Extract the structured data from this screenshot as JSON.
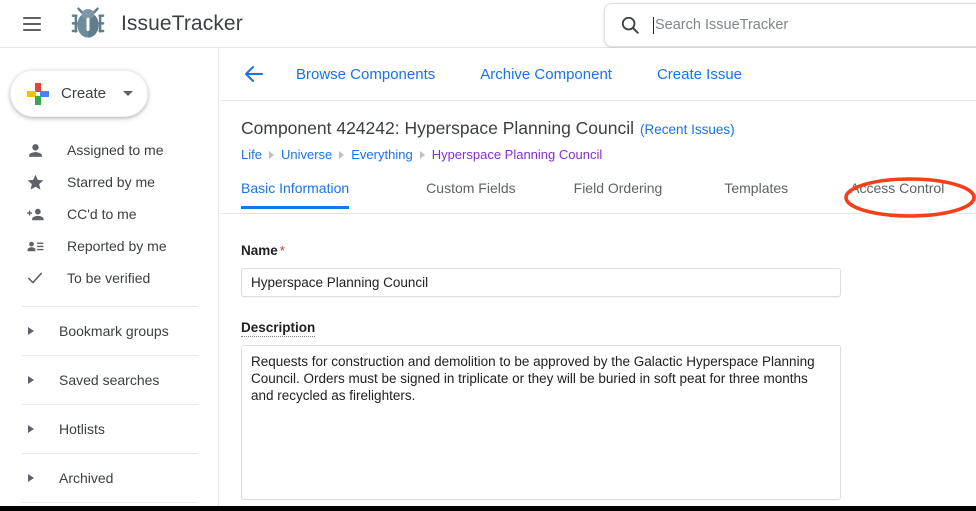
{
  "header": {
    "menu_icon": "hamburger-menu-icon",
    "logo_icon": "bug-logo-icon",
    "brand": "IssueTracker",
    "search": {
      "icon": "search-icon",
      "placeholder": "Search IssueTracker",
      "value": ""
    }
  },
  "sidebar": {
    "create": {
      "label": "Create",
      "plus_icon": "google-plus-icon",
      "caret_icon": "chevron-down-icon"
    },
    "nav_items": [
      {
        "label": "Assigned to me",
        "icon": "person-icon"
      },
      {
        "label": "Starred by me",
        "icon": "star-icon"
      },
      {
        "label": "CC'd to me",
        "icon": "person-add-icon"
      },
      {
        "label": "Reported by me",
        "icon": "person-list-icon"
      },
      {
        "label": "To be verified",
        "icon": "check-icon"
      }
    ],
    "groups": [
      {
        "label": "Bookmark groups",
        "icon": "triangle-right-icon"
      },
      {
        "label": "Saved searches",
        "icon": "triangle-right-icon"
      },
      {
        "label": "Hotlists",
        "icon": "triangle-right-icon"
      },
      {
        "label": "Archived",
        "icon": "triangle-right-icon"
      }
    ]
  },
  "main": {
    "back_icon": "arrow-left-icon",
    "actions": [
      {
        "label": "Browse Components"
      },
      {
        "label": "Archive Component"
      },
      {
        "label": "Create Issue"
      }
    ],
    "page_title": "Component 424242: Hyperspace Planning Council",
    "page_title_link": "(Recent Issues)",
    "breadcrumb": [
      {
        "label": "Life",
        "current": false
      },
      {
        "label": "Universe",
        "current": false
      },
      {
        "label": "Everything",
        "current": false
      },
      {
        "label": "Hyperspace Planning Council",
        "current": true
      }
    ],
    "tabs": [
      {
        "label": "Basic Information",
        "active": true
      },
      {
        "label": "Custom Fields",
        "active": false
      },
      {
        "label": "Field Ordering",
        "active": false
      },
      {
        "label": "Templates",
        "active": false
      },
      {
        "label": "Access Control",
        "active": false,
        "annotated": true
      }
    ],
    "form": {
      "name_label": "Name",
      "name_required_mark": "*",
      "name_value": "Hyperspace Planning Council",
      "description_label": "Description",
      "description_value": "Requests for construction and demolition to be approved by the Galactic Hyperspace Planning Council. Orders must be signed in triplicate or they will be buried in soft peat for three months and recycled as firelighters."
    }
  },
  "annotation": {
    "target": "Access Control",
    "shape": "ellipse",
    "color": "#F4401A"
  },
  "colors": {
    "link_blue": "#1a73e8",
    "visited_purple": "#8430ce",
    "required_red": "#d93025",
    "text_primary": "#3c4043",
    "annotation": "#F4401A",
    "logo": "#5f7d8c"
  }
}
